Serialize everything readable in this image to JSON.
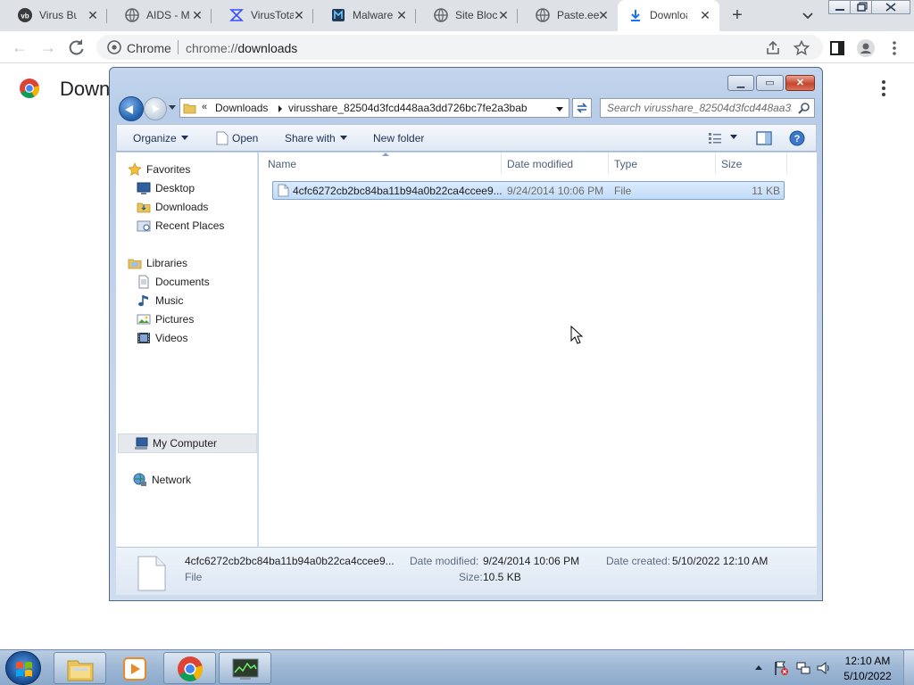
{
  "browser": {
    "tabs": [
      {
        "label": "Virus Bulle",
        "icon": "virusbulletin-icon"
      },
      {
        "label": "AIDS - M",
        "icon": "globe-icon"
      },
      {
        "label": "VirusTotal",
        "icon": "virustotal-icon"
      },
      {
        "label": "Malware",
        "icon": "malware-site-icon"
      },
      {
        "label": "Site Block",
        "icon": "globe-icon"
      },
      {
        "label": "Paste.ee",
        "icon": "globe-icon"
      },
      {
        "label": "Downloa",
        "icon": "download-icon",
        "active": true
      }
    ],
    "omnibox": {
      "chip": "Chrome",
      "url_scheme": "chrome://",
      "url_host": "downloads"
    },
    "page_title": "Down"
  },
  "explorer": {
    "window_title": "",
    "breadcrumb": {
      "overflow": "«",
      "items": [
        "Downloads",
        "virusshare_82504d3fcd448aa3dd726bc7fe2a3bab"
      ]
    },
    "search_placeholder": "Search virusshare_82504d3fcd448aa3...",
    "commands": {
      "organize": "Organize",
      "open": "Open",
      "share_with": "Share with",
      "new_folder": "New folder"
    },
    "nav": {
      "favorites": {
        "label": "Favorites",
        "items": [
          "Desktop",
          "Downloads",
          "Recent Places"
        ]
      },
      "libraries": {
        "label": "Libraries",
        "items": [
          "Documents",
          "Music",
          "Pictures",
          "Videos"
        ]
      },
      "computer": "My Computer",
      "network": "Network"
    },
    "columns": [
      "Name",
      "Date modified",
      "Type",
      "Size"
    ],
    "files": [
      {
        "name": "4cfc6272cb2bc84ba11b94a0b22ca4ccee9...",
        "date_modified": "9/24/2014 10:06 PM",
        "type": "File",
        "size": "11 KB"
      }
    ],
    "details": {
      "name": "4cfc6272cb2bc84ba11b94a0b22ca4ccee9...",
      "type": "File",
      "date_modified_label": "Date modified:",
      "date_modified": "9/24/2014 10:06 PM",
      "date_created_label": "Date created:",
      "date_created": "5/10/2022 12:10 AM",
      "size_label": "Size:",
      "size": "10.5 KB"
    }
  },
  "taskbar": {
    "time": "12:10 AM",
    "date": "5/10/2022",
    "apps": [
      "windows-explorer-icon",
      "media-player-icon",
      "chrome-icon",
      "network-monitor-icon"
    ]
  },
  "colors": {
    "chrome_tabstrip": "#dee1e6",
    "explorer_frame": "#c4d6ee",
    "selection": "#c2dcf7",
    "taskbar": "#9fb9d6"
  }
}
